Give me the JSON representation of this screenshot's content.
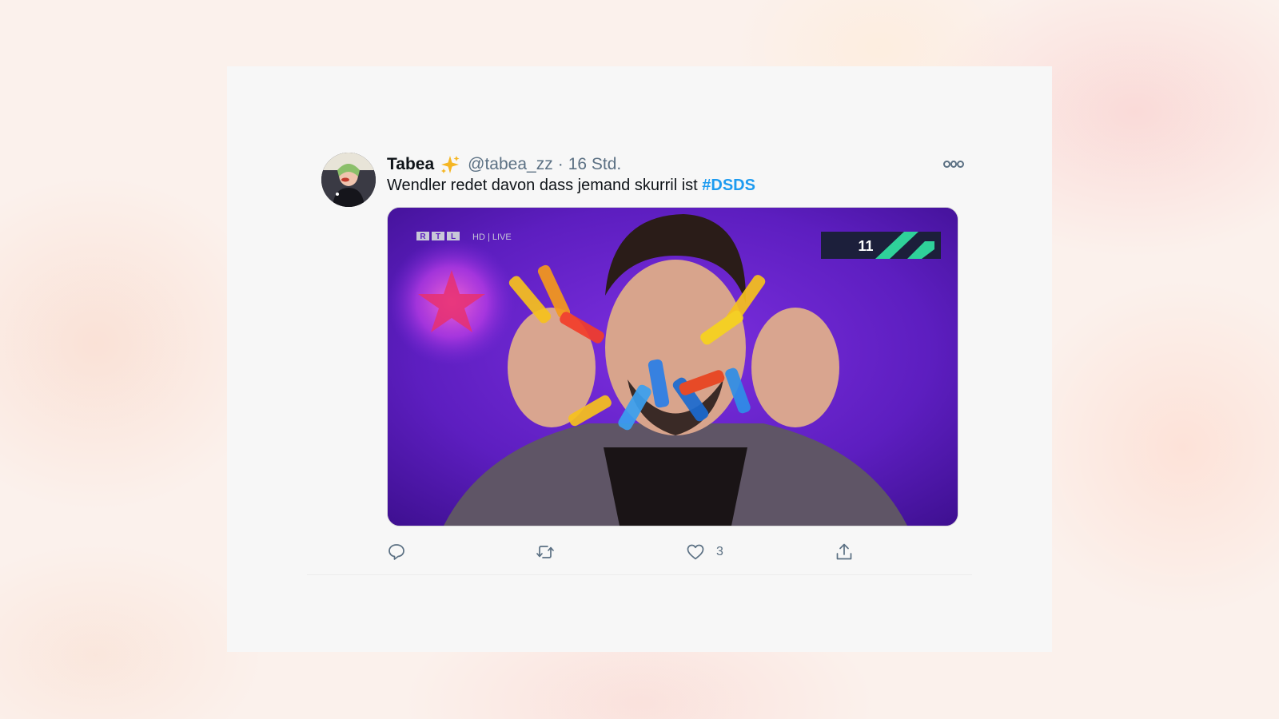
{
  "tweet": {
    "author_name": "Tabea",
    "handle": "@tabea_zz",
    "separator": "·",
    "timestamp": "16 Std.",
    "text": "Wendler redet davon dass jemand skurril ist ",
    "hashtag": "#DSDS",
    "hashtag_color": "#1d9bf0",
    "media": {
      "channel_logo": "RTL",
      "broadcast_label": "HD | LIVE",
      "score_badge": "11",
      "background_color": "#6a1fc4"
    },
    "actions": {
      "reply_icon": "reply-icon",
      "retweet_icon": "retweet-icon",
      "like_icon": "heart-icon",
      "like_count": "3",
      "share_icon": "share-icon"
    }
  },
  "colors": {
    "panel_background": "#f7f7f7",
    "secondary_text": "#5b7083",
    "primary_text": "#0f1419"
  }
}
